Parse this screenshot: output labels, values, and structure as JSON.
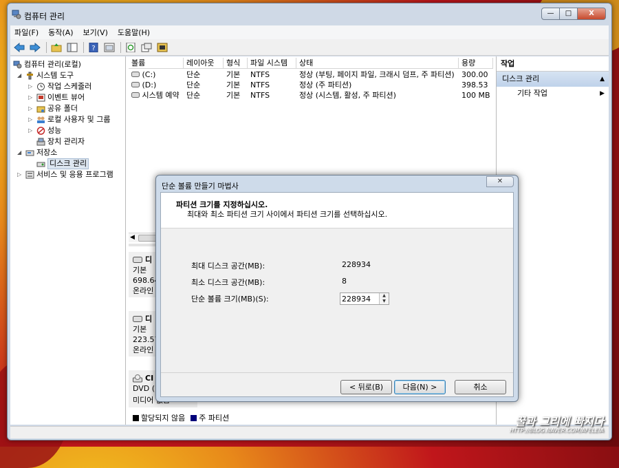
{
  "window": {
    "title": "컴퓨터 관리",
    "minimize": "—",
    "maximize": "□",
    "close": "X"
  },
  "menu": [
    "파일(F)",
    "동작(A)",
    "보기(V)",
    "도움말(H)"
  ],
  "toolbar_icons": [
    "back-icon",
    "forward-icon",
    "up-folder-icon",
    "show-tree-icon",
    "help-icon",
    "properties-icon",
    "refresh-icon",
    "action-icon",
    "wizard-icon"
  ],
  "tree": {
    "root": "컴퓨터 관리(로컬)",
    "system_tools": "시스템 도구",
    "task_scheduler": "작업 스케줄러",
    "event_viewer": "이벤트 뷰어",
    "shared_folders": "공유 폴더",
    "local_users": "로컬 사용자 및 그룹",
    "performance": "성능",
    "device_manager": "장치 관리자",
    "storage": "저장소",
    "disk_management": "디스크 관리",
    "services": "서비스 및 응용 프로그램"
  },
  "volumes": {
    "headers": [
      "볼륨",
      "레이아웃",
      "형식",
      "파일 시스템",
      "상태",
      "용량"
    ],
    "rows": [
      [
        "(C:)",
        "단순",
        "기본",
        "NTFS",
        "정상 (부팅, 페이지 파일, 크래시 덤프, 주 파티션)",
        "300.00"
      ],
      [
        "(D:)",
        "단순",
        "기본",
        "NTFS",
        "정상 (주 파티션)",
        "398.53"
      ],
      [
        "시스템 예약",
        "단순",
        "기본",
        "NTFS",
        "정상 (시스템, 활성, 주 파티션)",
        "100 MB"
      ]
    ]
  },
  "disks": [
    {
      "name": "디",
      "type": "기본",
      "size": "698.64",
      "status": "온라인"
    },
    {
      "name": "디",
      "type": "기본",
      "size": "223.57",
      "status": "온라인"
    },
    {
      "name": "CI",
      "type": "DVD (",
      "size": "",
      "status": "미디어 없음"
    }
  ],
  "legend": {
    "unallocated": "할당되지 않음",
    "primary": "주 파티션",
    "unallocated_color": "#000000",
    "primary_color": "#00007a"
  },
  "actions": {
    "header": "작업",
    "section": "디스크 관리",
    "more": "기타 작업"
  },
  "wizard": {
    "title": "단순 볼륨 만들기 마법사",
    "heading": "파티션 크기를 지정하십시오.",
    "subheading": "최대와 최소 파티션 크기 사이에서 파티션 크기를 선택하십시오.",
    "max_label": "최대 디스크 공간(MB):",
    "max_value": "228934",
    "min_label": "최소 디스크 공간(MB):",
    "min_value": "8",
    "size_label": "단순 볼륨 크기(MB)(S):",
    "size_value": "228934",
    "back": "< 뒤로(B)",
    "next": "다음(N) >",
    "cancel": "취소"
  },
  "watermark": {
    "text": "꿀과 그리에 빠지다",
    "url": "HTTP://BLOG.NAVER.COM/AFELEIA"
  }
}
